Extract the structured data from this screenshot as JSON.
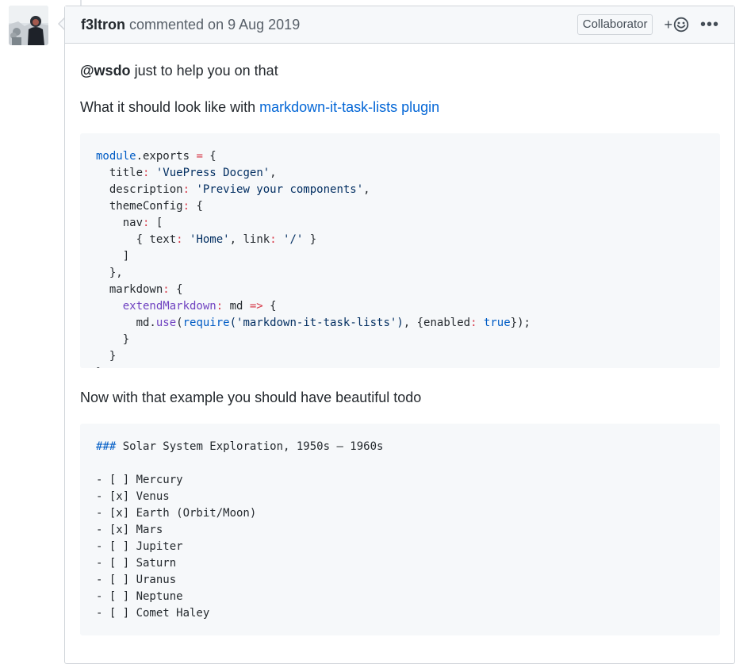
{
  "comment": {
    "author": "f3ltron",
    "action": "commented on",
    "date": "9 Aug 2019",
    "badge": "Collaborator",
    "reaction_plus": "+",
    "more_menu": "•••",
    "body": {
      "mention": "@wsdo",
      "line1_rest": " just to help you on that",
      "line2_text": "What it should look like with ",
      "line2_link": "markdown-it-task-lists plugin",
      "code1": {
        "module": "module",
        "exports_stmt": ".exports ",
        "eq": "=",
        "open": " {",
        "title_key": "  title",
        "title_val": " 'VuePress Docgen'",
        "desc_key": "  description",
        "desc_val": " 'Preview your components'",
        "theme_key": "  themeConfig",
        "theme_open": " {",
        "nav_key": "    nav",
        "nav_open": " [",
        "item_open": "      { text",
        "item_text_val": " 'Home'",
        "item_link_key": ", link",
        "item_link_val": " '/'",
        "item_close": " }",
        "nav_close": "    ]",
        "theme_close": "  },",
        "md_key": "  markdown",
        "md_open": " {",
        "ext_key": "    extendMarkdown",
        "ext_param": " md ",
        "arrow": "=>",
        "ext_open": " {",
        "use_obj": "      md.",
        "use_fn": "use",
        "paren_open": "(",
        "require_fn": "require",
        "req_arg": "('markdown-it-task-lists')",
        "opts_open": ", {enabled",
        "true_val": " true",
        "opts_close": "});",
        "ext_close": "    }",
        "md_close": "  }",
        "close": "}"
      },
      "line3": "Now with that example you should have beautiful todo",
      "code2": {
        "heading_marker": "###",
        "heading_text": " Solar System Exploration, 1950s – 1960s",
        "items": [
          "- [ ] Mercury",
          "- [x] Venus",
          "- [x] Earth (Orbit/Moon)",
          "- [x] Mars",
          "- [ ] Jupiter",
          "- [ ] Saturn",
          "- [ ] Uranus",
          "- [ ] Neptune",
          "- [ ] Comet Haley"
        ]
      }
    }
  },
  "colors": {
    "link": "#0366d6",
    "border": "#d1d5da",
    "header_bg": "#f6f8fa",
    "code_bg": "#f6f8fa",
    "syntax_blue": "#005cc5",
    "syntax_red": "#d73a49",
    "syntax_purple": "#6f42c1",
    "syntax_string": "#032f62"
  },
  "icons": [
    "avatar",
    "smiley-icon",
    "kebab-menu-icon"
  ]
}
